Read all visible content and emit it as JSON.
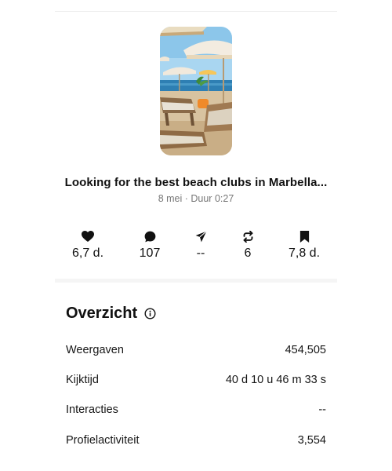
{
  "post": {
    "title": "Looking for the best beach clubs in Marbella...",
    "meta": "8 mei · Duur 0:27"
  },
  "stats": [
    {
      "name": "likes",
      "icon": "heart-icon",
      "value": "6,7 d."
    },
    {
      "name": "comments",
      "icon": "comment-icon",
      "value": "107"
    },
    {
      "name": "shares",
      "icon": "send-icon",
      "value": "--"
    },
    {
      "name": "reposts",
      "icon": "repost-icon",
      "value": "6"
    },
    {
      "name": "saves",
      "icon": "bookmark-icon",
      "value": "7,8 d."
    }
  ],
  "overview": {
    "title": "Overzicht",
    "info_icon": "info-icon",
    "metrics": [
      {
        "label": "Weergaven",
        "value": "454,505"
      },
      {
        "label": "Kijktijd",
        "value": "40 d 10 u 46 m 33 s"
      },
      {
        "label": "Interacties",
        "value": "--"
      },
      {
        "label": "Profielactiviteit",
        "value": "3,554"
      }
    ]
  }
}
